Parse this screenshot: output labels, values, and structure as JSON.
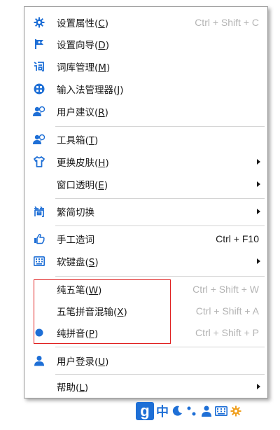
{
  "menu": {
    "items": [
      {
        "label": "设置属性",
        "mnemonic": "C",
        "shortcut": "Ctrl + Shift + C",
        "icon": "gear-icon"
      },
      {
        "label": "设置向导",
        "mnemonic": "D",
        "icon": "flag-icon"
      },
      {
        "label": "词库管理",
        "mnemonic": "M",
        "icon": "ci-char-icon"
      },
      {
        "label": "输入法管理器",
        "mnemonic": "J",
        "icon": "grid-circle-icon"
      },
      {
        "label": "用户建议",
        "mnemonic": "R",
        "icon": "user-chat-icon"
      },
      {
        "label": "工具箱",
        "mnemonic": "T",
        "icon": "user-chat-icon"
      },
      {
        "label": "更换皮肤",
        "mnemonic": "H",
        "icon": "shirt-icon"
      },
      {
        "label": "窗口透明",
        "mnemonic": "E"
      },
      {
        "label": "繁简切换",
        "icon": "jian-char-icon"
      },
      {
        "label": "手工造词",
        "shortcut": "Ctrl + F10",
        "icon": "hand-point-icon"
      },
      {
        "label": "软键盘",
        "mnemonic": "S",
        "icon": "keyboard-icon"
      },
      {
        "label": "纯五笔",
        "mnemonic": "W",
        "shortcut": "Ctrl + Shift + W"
      },
      {
        "label": "五笔拼音混输",
        "mnemonic": "X",
        "shortcut": "Ctrl + Shift + A"
      },
      {
        "label": "纯拼音",
        "mnemonic": "P",
        "shortcut": "Ctrl + Shift + P",
        "icon": "selected-dot-icon"
      },
      {
        "label": "用户登录",
        "mnemonic": "U",
        "icon": "user-icon"
      },
      {
        "label": "帮助",
        "mnemonic": "L"
      }
    ]
  },
  "taskbar": {
    "logo": "g",
    "mode": "中"
  },
  "colors": {
    "accent": "#1e6fd6",
    "highlight_box": "#e02020",
    "disabled_text": "#b4b4b4"
  }
}
